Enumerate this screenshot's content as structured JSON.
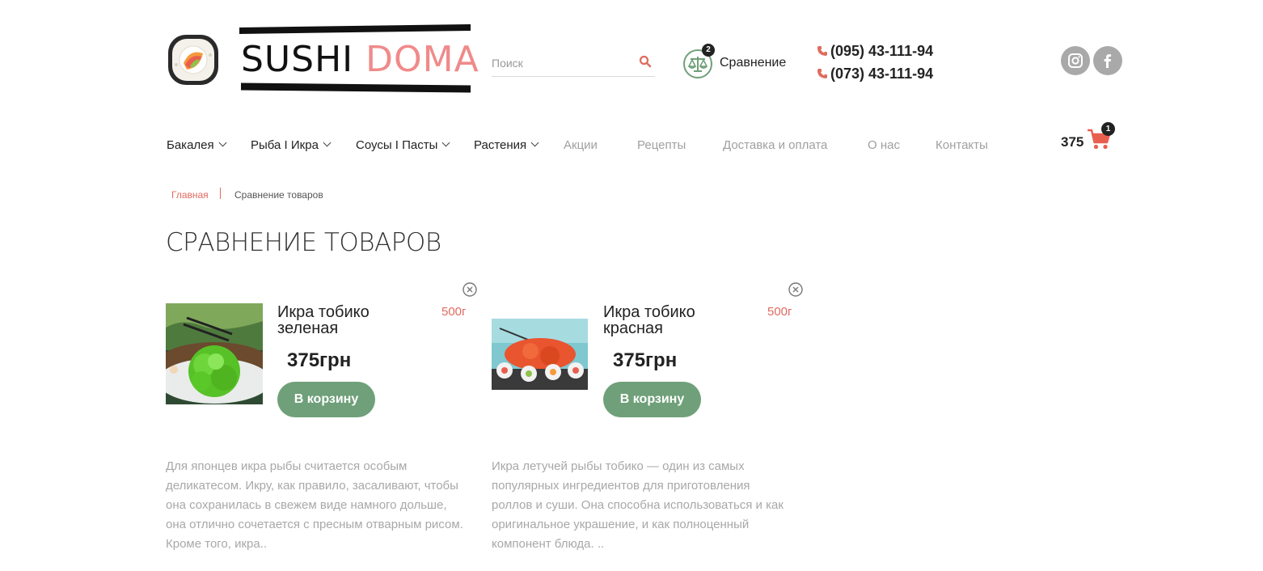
{
  "header": {
    "logo": {
      "word1": "SUSHI",
      "word2": "DOMA"
    },
    "search": {
      "placeholder": "Поиск",
      "value": ""
    },
    "compare": {
      "label": "Сравнение",
      "count": "2"
    },
    "phones": [
      "(095) 43-111-94",
      "(073) 43-111-94"
    ],
    "social": [
      {
        "icon": "instagram-icon"
      },
      {
        "icon": "facebook-icon"
      }
    ],
    "cart": {
      "total": "375",
      "count": "1"
    }
  },
  "nav": [
    {
      "label": "Бакалея",
      "dropdown": true
    },
    {
      "label": "Рыба I Икра",
      "dropdown": true
    },
    {
      "label": "Соусы I Пасты",
      "dropdown": true
    },
    {
      "label": "Растения",
      "dropdown": true
    },
    {
      "label": "Акции",
      "dropdown": false
    },
    {
      "label": "Рецепты",
      "dropdown": false
    },
    {
      "label": "Доставка и оплата",
      "dropdown": false
    },
    {
      "label": "О нас",
      "dropdown": false
    },
    {
      "label": "Контакты",
      "dropdown": false
    }
  ],
  "breadcrumb": {
    "home": "Главная",
    "current": "Сравнение товаров"
  },
  "page_title": "СРАВНЕНИЕ ТОВАРОВ",
  "products": [
    {
      "name": "Икра тобико зеленая",
      "weight": "500г",
      "price": "375грн",
      "button": "В корзину",
      "description": "Для японцев икра рыбы считается особым деликатесом. Икру, как правило, засаливают, чтобы она сохранилась в свежем виде намного дольше, она отлично сочетается с пресным отварным рисом. Кроме того, икра.."
    },
    {
      "name": "Икра тобико красная",
      "weight": "500г",
      "price": "375грн",
      "button": "В корзину",
      "description": "Икра летучей рыбы тобико — один из самых популярных ингредиентов для приготовления роллов и суши. Она способна использоваться и как оригинальное украшение, и как полноценный компонент блюда. .."
    }
  ],
  "colors": {
    "accent": "#e06b5f",
    "button": "#6fa079",
    "logo_pink": "#f08a8a",
    "compare_green": "#6fa079"
  }
}
